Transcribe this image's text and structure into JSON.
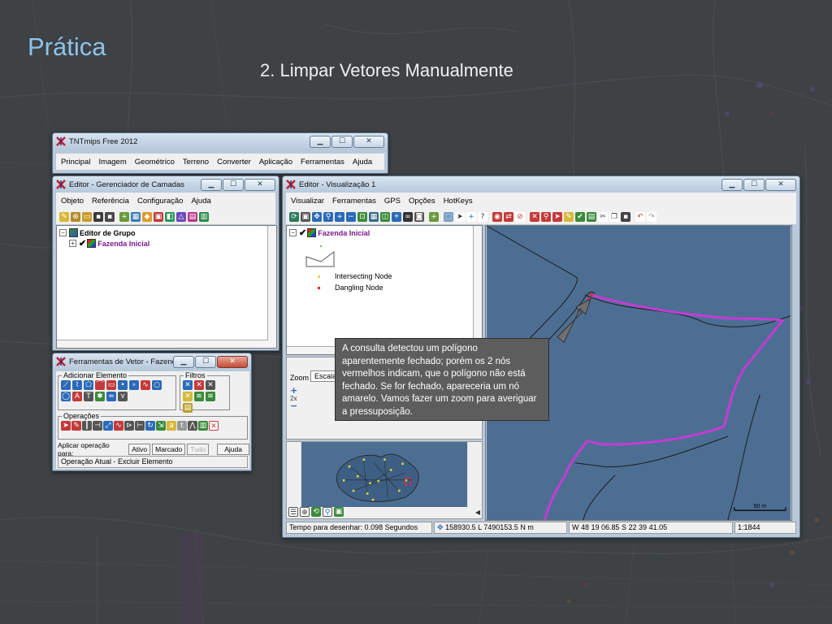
{
  "slide": {
    "title": "Prática",
    "subtitle": "2. Limpar Vetores Manualmente"
  },
  "main_window": {
    "title": "TNTmips Free 2012",
    "menu": [
      "Principal",
      "Imagem",
      "Geométrico",
      "Terreno",
      "Converter",
      "Aplicação",
      "Ferramentas",
      "Ajuda"
    ]
  },
  "layer_manager": {
    "title": "Editor - Gerenciador de Camadas",
    "menu": [
      "Objeto",
      "Referência",
      "Configuração",
      "Ajuda"
    ],
    "tree": {
      "group_label": "Editor de Grupo",
      "layer_label": "Fazenda Inicial"
    }
  },
  "vector_tools": {
    "title": "Ferramentas de Vetor - Fazenda I...",
    "add_group_label": "Adicionar Elemento",
    "filters_group_label": "Filtros",
    "operations_group_label": "Operações",
    "apply_label": "Aplicar operação para:",
    "apply_buttons": [
      "Ativo",
      "Marcado",
      "Tudo",
      "Ajuda"
    ],
    "status": "Operação Atual - Excluir Elemento"
  },
  "view_window": {
    "title": "Editor - Visualização 1",
    "menu": [
      "Visualizar",
      "Ferramentas",
      "GPS",
      "Opções",
      "HotKeys"
    ],
    "legend": {
      "layer_label": "Fazenda Inicial",
      "items": [
        "Intersecting Node",
        "Dangling Node"
      ]
    },
    "zoom_label": "Zoom",
    "scale_tab_label": "Escala",
    "zoom_factor": "2x",
    "scale_bar_label": "50 m",
    "status": {
      "draw_time": "Tempo para desenhar: 0.098 Segundos",
      "coords": "158930.5 L  7490153.5 N m",
      "latlon": "W 48 19 06.85  S 22 39 41.05",
      "scale": "1:1844"
    }
  },
  "callout": {
    "text": "A consulta detectou um polígono aparentemente fechado; porém os 2 nós vermelhos indicam, que o polígono não está fechado. Se for fechado, apareceria um nó amarelo. Vamos fazer um zoom para averiguar a pressuposição."
  },
  "colors": {
    "map_background": "#4d6e93",
    "polygon_line": "#c43bd6",
    "title_accent": "#8fc3ea",
    "dangling_node": "#e8243a",
    "callout_bg": "#5d5d5d"
  }
}
